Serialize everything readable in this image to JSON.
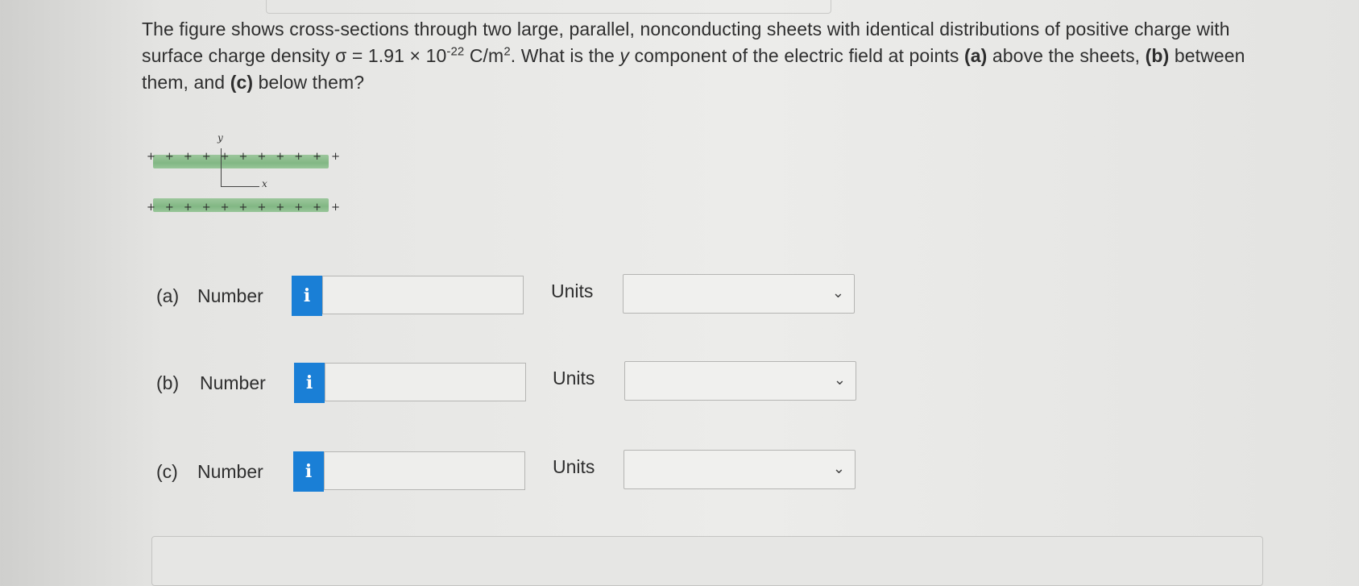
{
  "question": {
    "part1": "The figure shows cross-sections through two large, parallel, nonconducting sheets with identical distributions of positive charge with surface charge density σ = 1.91 × 10",
    "exp1": "-22",
    "part2": " C/m",
    "exp2": "2",
    "part3": ". What is the ",
    "var": "y",
    "part4": " component of the electric field at points ",
    "a_tag": "(a)",
    "part5": " above the sheets, ",
    "b_tag": "(b)",
    "part6": " between them, and ",
    "c_tag": "(c)",
    "part7": " below them?"
  },
  "figure": {
    "y_label": "y",
    "x_label": "x",
    "top_plus": [
      "+",
      "+",
      "+",
      "+",
      "+",
      "+",
      "+",
      "+",
      "+",
      "+",
      "+"
    ],
    "bottom_plus": [
      "+",
      "+",
      "+",
      "+",
      "+",
      "+",
      "+",
      "+",
      "+",
      "+",
      "+"
    ],
    "sheet_color": "#86b98a"
  },
  "rows": [
    {
      "part": "(a)",
      "number_label": "Number",
      "info": "i",
      "value": "",
      "units_label": "Units",
      "units_value": ""
    },
    {
      "part": "(b)",
      "number_label": "Number",
      "info": "i",
      "value": "",
      "units_label": "Units",
      "units_value": ""
    },
    {
      "part": "(c)",
      "number_label": "Number",
      "info": "i",
      "value": "",
      "units_label": "Units",
      "units_value": ""
    }
  ],
  "colors": {
    "info_button": "#1a7fd6"
  },
  "icons": {
    "info": "info-icon",
    "dropdown": "chevron-down-icon"
  }
}
